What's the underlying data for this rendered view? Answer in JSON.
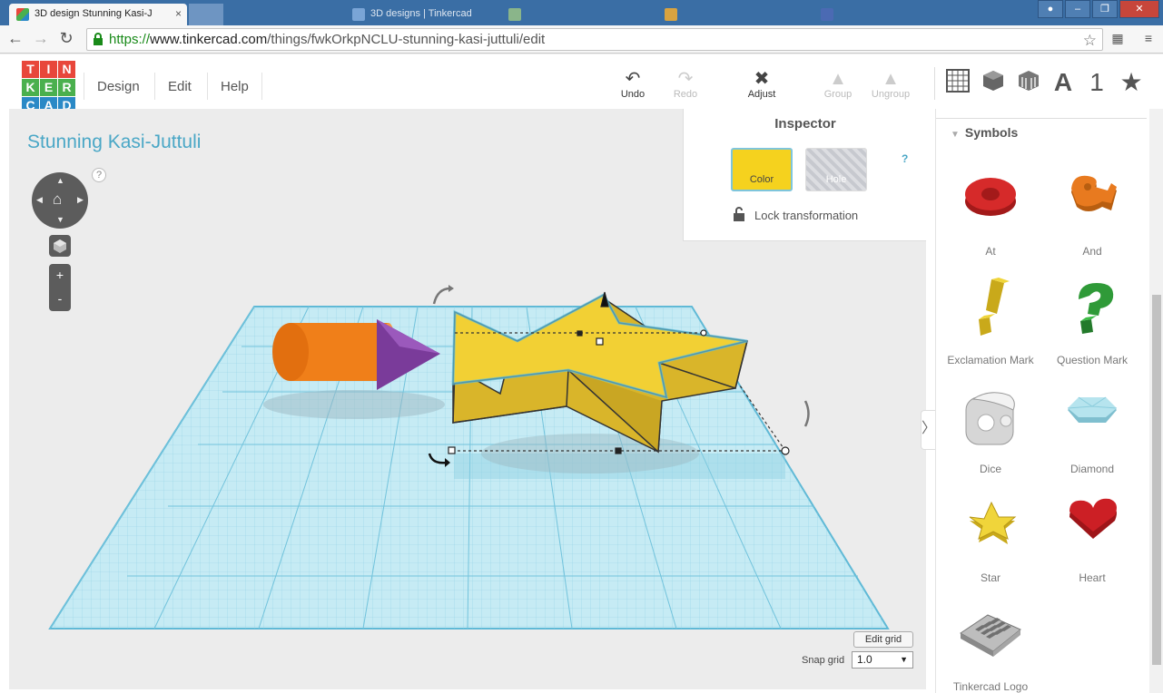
{
  "browser": {
    "tabs": [
      {
        "title": "3D design Stunning Kasi-J",
        "active": true
      },
      {
        "title": "",
        "active": false
      },
      {
        "title": "",
        "active": false
      },
      {
        "title": "3D designs | Tinkercad",
        "active": false
      },
      {
        "title": "",
        "active": false
      },
      {
        "title": "",
        "active": false
      },
      {
        "title": "",
        "active": false
      }
    ],
    "url_scheme": "https://",
    "url_host": "www.tinkercad.com",
    "url_path": "/things/fwkOrkpNCLU-stunning-kasi-juttuli/edit"
  },
  "app": {
    "logo_letters": [
      "T",
      "I",
      "N",
      "K",
      "E",
      "R",
      "C",
      "A",
      "D"
    ],
    "logo_colors": [
      "#e8473b",
      "#e8473b",
      "#e8473b",
      "#4ab04e",
      "#4ab04e",
      "#4ab04e",
      "#2a89c6",
      "#2a89c6",
      "#2a89c6"
    ],
    "menu": {
      "design": "Design",
      "edit": "Edit",
      "help": "Help"
    },
    "tools": {
      "undo": "Undo",
      "redo": "Redo",
      "adjust": "Adjust",
      "group": "Group",
      "ungroup": "Ungroup"
    },
    "view_icons": [
      "grid-view",
      "box-view",
      "wireframe-view",
      "A",
      "1",
      "★"
    ]
  },
  "design": {
    "title": "Stunning Kasi-Juttuli",
    "help_symbol": "?",
    "zoom_in": "+",
    "zoom_out": "-"
  },
  "inspector": {
    "title": "Inspector",
    "color_label": "Color",
    "hole_label": "Hole",
    "help": "?",
    "lock_label": "Lock transformation",
    "selected_color": "#f5d21e"
  },
  "grid": {
    "edit_grid": "Edit grid",
    "snap_label": "Snap grid",
    "snap_value": "1.0"
  },
  "library": {
    "section": "Symbols",
    "shapes": [
      {
        "name": "At",
        "icon": "at-shape-icon",
        "color": "#d62a2a"
      },
      {
        "name": "And",
        "icon": "ampersand-shape-icon",
        "color": "#e87a1f"
      },
      {
        "name": "Exclamation Mark",
        "icon": "exclamation-shape-icon",
        "color": "#e8c91f"
      },
      {
        "name": "Question Mark",
        "icon": "question-shape-icon",
        "color": "#2f9a38"
      },
      {
        "name": "Dice",
        "icon": "dice-shape-icon",
        "color": "#e6e6e6"
      },
      {
        "name": "Diamond",
        "icon": "diamond-shape-icon",
        "color": "#9fd8e6"
      },
      {
        "name": "Star",
        "icon": "star-shape-icon",
        "color": "#e8c91f"
      },
      {
        "name": "Heart",
        "icon": "heart-shape-icon",
        "color": "#cc1f25"
      },
      {
        "name": "Tinkercad Logo",
        "icon": "tinkercad-logo-shape-icon",
        "color": "#9a9a9a"
      }
    ]
  }
}
